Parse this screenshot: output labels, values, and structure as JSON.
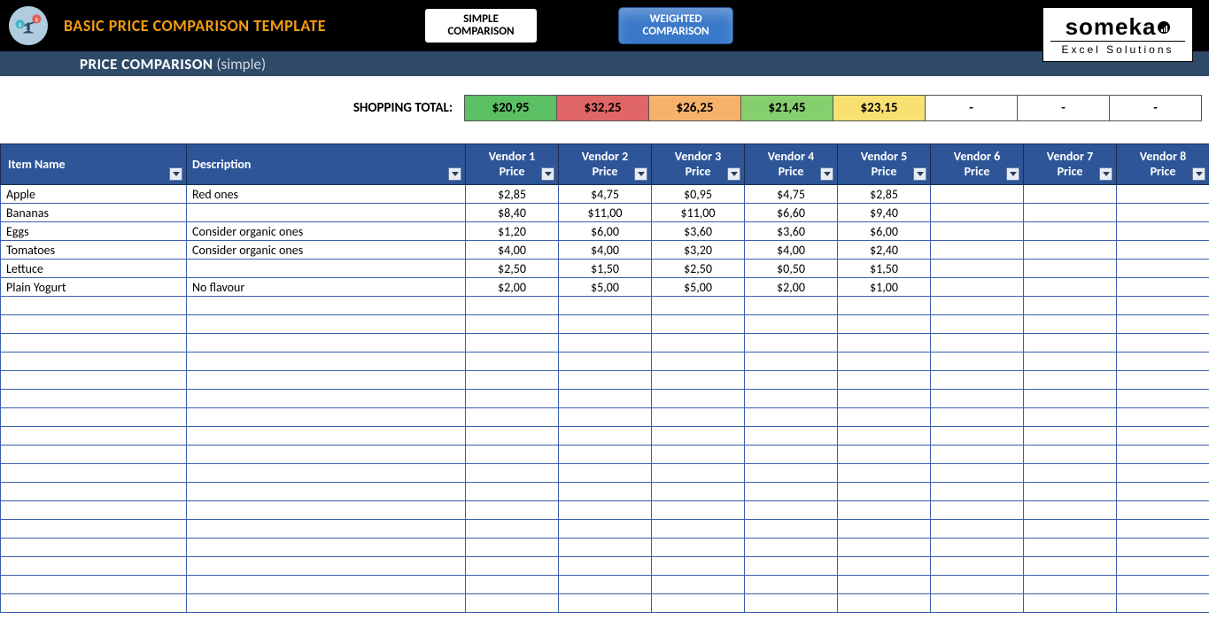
{
  "header": {
    "title": "BASIC PRICE COMPARISON TEMPLATE",
    "subtitle_main": "PRICE COMPARISON",
    "subtitle_suffix": "(simple)",
    "tab_simple_l1": "SIMPLE",
    "tab_simple_l2": "COMPARISON",
    "tab_weighted_l1": "WEIGHTED",
    "tab_weighted_l2": "COMPARISON",
    "logo_main": "someka",
    "logo_sub": "Excel Solutions"
  },
  "totals": {
    "label": "SHOPPING TOTAL:",
    "cells": [
      "$20,95",
      "$32,25",
      "$26,25",
      "$21,45",
      "$23,15",
      "-",
      "-",
      "-"
    ],
    "colors": [
      "c-green",
      "c-red",
      "c-orange",
      "c-lgreen",
      "c-yellow",
      "c-blank",
      "c-blank",
      "c-blank"
    ]
  },
  "columns": {
    "item": "Item Name",
    "desc": "Description",
    "vendors": [
      {
        "l1": "Vendor 1",
        "l2": "Price"
      },
      {
        "l1": "Vendor 2",
        "l2": "Price"
      },
      {
        "l1": "Vendor 3",
        "l2": "Price"
      },
      {
        "l1": "Vendor 4",
        "l2": "Price"
      },
      {
        "l1": "Vendor 5",
        "l2": "Price"
      },
      {
        "l1": "Vendor 6",
        "l2": "Price"
      },
      {
        "l1": "Vendor 7",
        "l2": "Price"
      },
      {
        "l1": "Vendor 8",
        "l2": "Price"
      }
    ]
  },
  "rows": [
    {
      "name": "Apple",
      "desc": "Red ones",
      "p": [
        "$2,85",
        "$4,75",
        "$0,95",
        "$4,75",
        "$2,85",
        "",
        "",
        ""
      ]
    },
    {
      "name": "Bananas",
      "desc": "",
      "p": [
        "$8,40",
        "$11,00",
        "$11,00",
        "$6,60",
        "$9,40",
        "",
        "",
        ""
      ]
    },
    {
      "name": "Eggs",
      "desc": "Consider organic ones",
      "p": [
        "$1,20",
        "$6,00",
        "$3,60",
        "$3,60",
        "$6,00",
        "",
        "",
        ""
      ]
    },
    {
      "name": "Tomatoes",
      "desc": "Consider organic ones",
      "p": [
        "$4,00",
        "$4,00",
        "$3,20",
        "$4,00",
        "$2,40",
        "",
        "",
        ""
      ]
    },
    {
      "name": "Lettuce",
      "desc": "",
      "p": [
        "$2,50",
        "$1,50",
        "$2,50",
        "$0,50",
        "$1,50",
        "",
        "",
        ""
      ]
    },
    {
      "name": "Plain Yogurt",
      "desc": "No flavour",
      "p": [
        "$2,00",
        "$5,00",
        "$5,00",
        "$2,00",
        "$1,00",
        "",
        "",
        ""
      ]
    }
  ],
  "empty_rows": 17
}
